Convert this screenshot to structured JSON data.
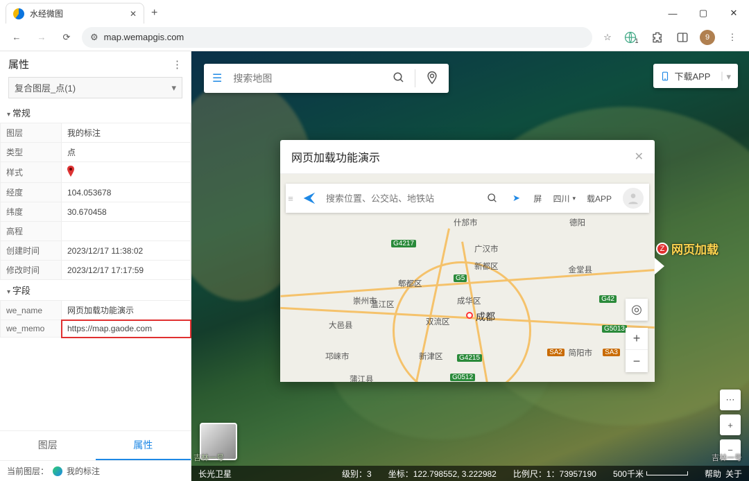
{
  "browser": {
    "tab_title": "水经微图",
    "url": "map.wemapgis.com",
    "avatar": "9"
  },
  "sidebar": {
    "title": "属性",
    "dropdown": "复合图层_点(1)",
    "section_general": "常规",
    "section_fields": "字段",
    "props": {
      "layer_k": "图层",
      "layer_v": "我的标注",
      "type_k": "类型",
      "type_v": "点",
      "style_k": "样式",
      "lng_k": "经度",
      "lng_v": "104.053678",
      "lat_k": "纬度",
      "lat_v": "30.670458",
      "elev_k": "高程",
      "elev_v": "",
      "ctime_k": "创建时间",
      "ctime_v": "2023/12/17  11:38:02",
      "mtime_k": "修改时间",
      "mtime_v": "2023/12/17  17:17:59",
      "name_k": "we_name",
      "name_v": "网页加载功能演示",
      "memo_k": "we_memo",
      "memo_v": "https://map.gaode.com"
    },
    "tabs": {
      "layer": "图层",
      "attr": "属性"
    },
    "status_label": "当前图层：",
    "status_value": "我的标注"
  },
  "map": {
    "search_placeholder": "搜索地图",
    "download_app": "下载APP",
    "marker_label": "网页加载",
    "thumb": "",
    "status": {
      "provider": "长光卫星",
      "level_k": "级别：",
      "level_v": "3",
      "coord_k": "坐标：",
      "coord_v": "122.798552,   3.222982",
      "scale_k": "比例尺：",
      "scale_v": "1：73957190",
      "dist": "500千米",
      "help": "帮助",
      "about": "关于"
    },
    "attrib_left": "吉林一号",
    "attrib_right": "吉林一号"
  },
  "popup": {
    "title": "网页加载功能演示",
    "gaode": {
      "placeholder": "搜索位置、公交站、地铁站",
      "region": "四川",
      "app": "载APP",
      "f": "屏"
    },
    "places": {
      "shifang": "什邡市",
      "deyang": "德阳",
      "guanghan": "广汉市",
      "jintang": "金堂县",
      "xindu": "新都区",
      "pidu": "郫都区",
      "wenjiang": "温江区",
      "chenghua": "成华区",
      "shuangliu": "双流区",
      "chengdu": "成都",
      "chongzhou": "崇州市",
      "dayi": "大邑县",
      "qionglai": "邛崃市",
      "xinjin": "新津区",
      "pujiang": "蒲江县",
      "jianyang": "简阳市"
    },
    "roads": {
      "g5": "G5",
      "g42": "G42",
      "g4217": "G4217",
      "g4215": "G4215",
      "g0512": "G0512",
      "g5013": "G5013",
      "sa2": "SA2",
      "sa3": "SA3"
    }
  }
}
